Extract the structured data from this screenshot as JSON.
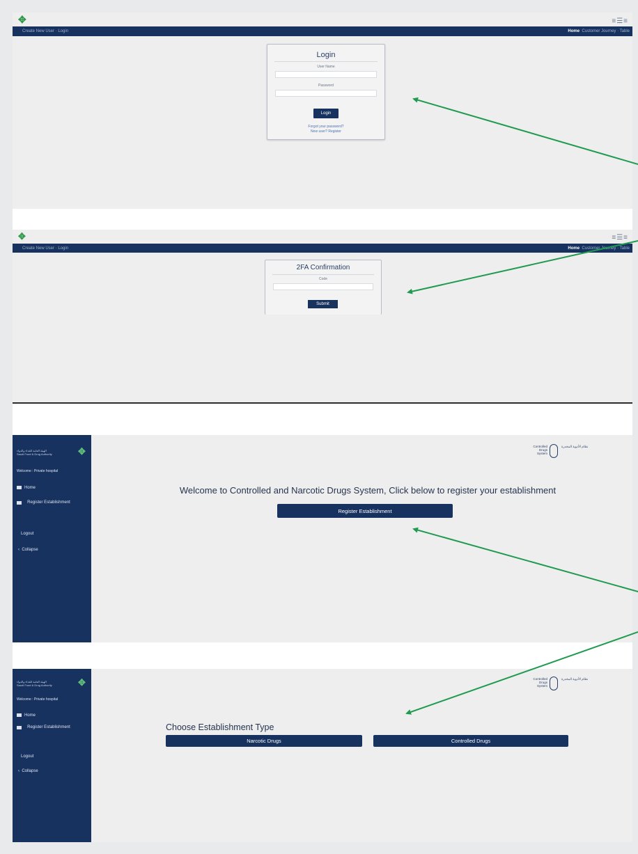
{
  "login_screen": {
    "nav_left": "Create New User · Login",
    "nav_home": "Home",
    "nav_right_rest": "Customer Journey · Table",
    "header_icons": "≡☰≡",
    "card": {
      "title": "Login",
      "username_label": "User Name",
      "password_label": "Password",
      "button": "Login",
      "forgot_link": "Forgot your password?",
      "register_link": "New user? Register"
    }
  },
  "twofa_screen": {
    "nav_left": "Create New User · Login",
    "nav_home": "Home",
    "nav_right_rest": "Customer Journey · Table",
    "header_icons": "≡☰≡",
    "card": {
      "title": "2FA Confirmation",
      "code_label": "Code",
      "button": "Submit"
    }
  },
  "register_screen": {
    "sidebar": {
      "org_name_ar": "الهيئة العامة للغذاء والدواء",
      "org_name_en": "Saudi Food & Drug Authority",
      "welcome": "Welcome : Private hospital",
      "home": "Home",
      "register": "Register Establishment",
      "logout": "Logout",
      "collapse": "Collapse"
    },
    "system_logo": {
      "en": "Controlled Drugs System",
      "ar": "نظام الأدوية المخدرة"
    },
    "heading": "Welcome to Controlled and Narcotic Drugs System, Click below to register your establishment",
    "register_button": "Register Establishment"
  },
  "type_screen": {
    "sidebar": {
      "org_name_ar": "الهيئة العامة للغذاء والدواء",
      "org_name_en": "Saudi Food & Drug Authority",
      "welcome": "Welcome : Private hospital",
      "home": "Home",
      "register": "Register Establishment",
      "logout": "Logout",
      "collapse": "Collapse"
    },
    "system_logo": {
      "en": "Controlled Drugs System",
      "ar": "نظام الأدوية المخدرة"
    },
    "heading": "Choose Establishment Type",
    "narcotic_button": "Narcotic Drugs",
    "controlled_button": "Controlled Drugs"
  },
  "colors": {
    "navy": "#17325f",
    "arrow_green": "#1f9a4f",
    "page_bg": "#eeeeee"
  }
}
